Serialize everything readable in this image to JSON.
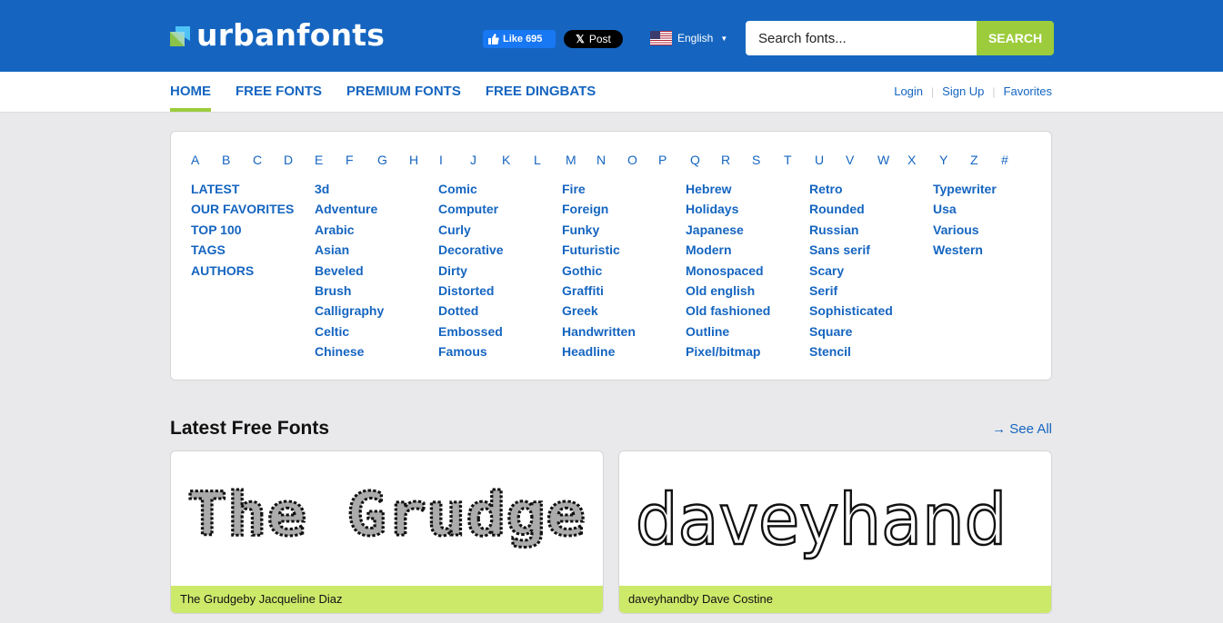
{
  "header": {
    "logo_text": "urbanfonts",
    "fb_like": "Like 695",
    "x_post": "Post",
    "language": "English",
    "search_placeholder": "Search fonts...",
    "search_button": "SEARCH",
    "colors": {
      "brand_blue": "#1565c0",
      "accent_green": "#9ccc3c"
    }
  },
  "nav": {
    "items": [
      {
        "label": "HOME",
        "active": true
      },
      {
        "label": "FREE FONTS"
      },
      {
        "label": "PREMIUM FONTS"
      },
      {
        "label": "FREE DINGBATS"
      }
    ],
    "login": "Login",
    "signup": "Sign Up",
    "favorites": "Favorites"
  },
  "alphabet": [
    "A",
    "B",
    "C",
    "D",
    "E",
    "F",
    "G",
    "H",
    "I",
    "J",
    "K",
    "L",
    "M",
    "N",
    "O",
    "P",
    "Q",
    "R",
    "S",
    "T",
    "U",
    "V",
    "W",
    "X",
    "Y",
    "Z",
    "#"
  ],
  "categories": [
    [
      "LATEST",
      "OUR FAVORITES",
      "TOP 100",
      "TAGS",
      "AUTHORS"
    ],
    [
      "3d",
      "Adventure",
      "Arabic",
      "Asian",
      "Beveled",
      "Brush",
      "Calligraphy",
      "Celtic",
      "Chinese"
    ],
    [
      "Comic",
      "Computer",
      "Curly",
      "Decorative",
      "Dirty",
      "Distorted",
      "Dotted",
      "Embossed",
      "Famous"
    ],
    [
      "Fire",
      "Foreign",
      "Funky",
      "Futuristic",
      "Gothic",
      "Graffiti",
      "Greek",
      "Handwritten",
      "Headline"
    ],
    [
      "Hebrew",
      "Holidays",
      "Japanese",
      "Modern",
      "Monospaced",
      "Old english",
      "Old fashioned",
      "Outline",
      "Pixel/bitmap"
    ],
    [
      "Retro",
      "Rounded",
      "Russian",
      "Sans serif",
      "Scary",
      "Serif",
      "Sophisticated",
      "Square",
      "Stencil"
    ],
    [
      "Typewriter",
      "Usa",
      "Various",
      "Western"
    ]
  ],
  "latest": {
    "title": "Latest Free Fonts",
    "see_all": "→ See All",
    "cards": [
      {
        "preview_text": "The Grudge",
        "caption": "The Grudgeby Jacqueline Diaz"
      },
      {
        "preview_text": "daveyhand",
        "caption": "daveyhandby Dave Costine"
      }
    ]
  }
}
